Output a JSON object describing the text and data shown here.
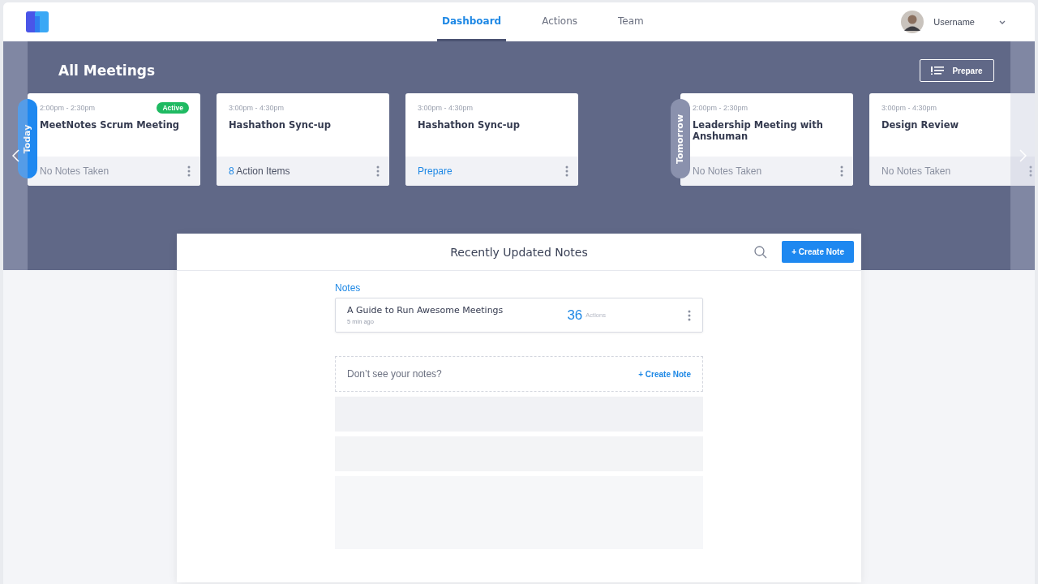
{
  "nav": {
    "tabs": [
      {
        "label": "Dashboard",
        "selected": true
      },
      {
        "label": "Actions",
        "selected": false
      },
      {
        "label": "Team",
        "selected": false
      }
    ],
    "user": {
      "name": "Username"
    }
  },
  "meetings": {
    "title": "All Meetings",
    "prepare_button": "Prepare",
    "days": [
      {
        "label": "Today",
        "selected": true,
        "cards": [
          {
            "time": "2:00pm - 2:30pm",
            "title": "MeetNotes Scrum Meeting",
            "badge": "Active",
            "footer": {
              "kind": "none",
              "text": "No Notes Taken"
            }
          },
          {
            "time": "3:00pm - 4:30pm",
            "title": "Hashathon Sync-up",
            "footer": {
              "kind": "actions",
              "count": "8",
              "text": "Action Items"
            }
          },
          {
            "time": "3:00pm - 4:30pm",
            "title": "Hashathon Sync-up",
            "footer": {
              "kind": "prepare",
              "text": "Prepare"
            }
          }
        ]
      },
      {
        "label": "Tomorrow",
        "selected": false,
        "cards": [
          {
            "time": "2:00pm - 2:30pm",
            "title": "Leadership Meeting with Anshuman",
            "footer": {
              "kind": "none",
              "text": "No Notes Taken"
            }
          },
          {
            "time": "3:00pm - 4:30pm",
            "title": "Design Review",
            "footer": {
              "kind": "none",
              "text": "No Notes Taken"
            }
          }
        ]
      }
    ]
  },
  "notes_panel": {
    "title": "Recently Updated Notes",
    "create_button": "+ Create Note",
    "section_label": "Notes",
    "notes": [
      {
        "title": "A Guide to Run Awesome Meetings",
        "time": "5 min ago",
        "count": "36",
        "count_label": "Actions"
      }
    ],
    "empty_prompt": {
      "text": "Don’t see your notes?",
      "link": "+ Create Note"
    }
  }
}
